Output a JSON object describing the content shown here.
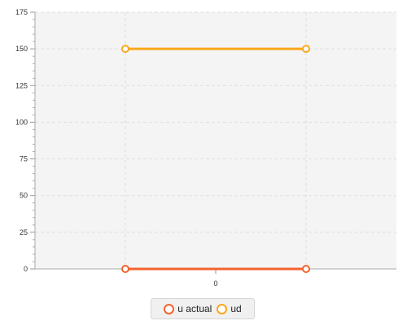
{
  "chart_data": {
    "type": "line",
    "title": "",
    "xlabel": "",
    "ylabel": "",
    "ylim": [
      0,
      175
    ],
    "y_ticks": [
      "0",
      "25",
      "50",
      "75",
      "100",
      "125",
      "150",
      "175"
    ],
    "x_tick_label": "0",
    "grid": true,
    "legend_position": "bottom",
    "series": [
      {
        "name": "u actual",
        "color": "#f3622d",
        "points": [
          {
            "x": -0.5,
            "y": 0
          },
          {
            "x": 0.5,
            "y": 0
          }
        ]
      },
      {
        "name": "ud",
        "color": "#fba71b",
        "points": [
          {
            "x": -0.5,
            "y": 150
          },
          {
            "x": 0.5,
            "y": 150
          }
        ]
      }
    ]
  }
}
